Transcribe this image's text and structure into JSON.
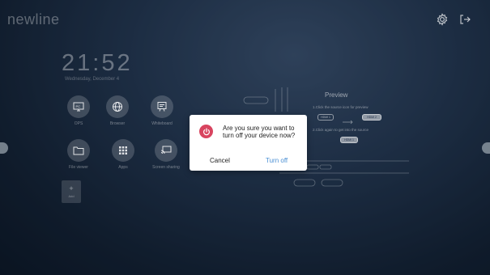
{
  "brand": {
    "logo_text": "newline"
  },
  "top_bar": {
    "settings_icon": "gear-icon",
    "exit_icon": "exit-icon"
  },
  "clock": {
    "time": "21:52",
    "date": "Wednesday, December 4"
  },
  "apps": [
    {
      "label": "OPS",
      "icon": "pc-icon"
    },
    {
      "label": "Browser",
      "icon": "globe-icon"
    },
    {
      "label": "Whiteboard",
      "icon": "whiteboard-icon"
    },
    {
      "label": "File viewer",
      "icon": "folder-icon"
    },
    {
      "label": "Apps",
      "icon": "grid-icon"
    },
    {
      "label": "Screen sharing",
      "icon": "cast-icon"
    }
  ],
  "add_tile": {
    "label": "Add"
  },
  "preview": {
    "title": "Preview",
    "step1": "1.Click the source icon for preview",
    "step2": "2.Click again to get into the source",
    "source_a": "HDMI 1",
    "source_b": "HDMI 2",
    "source_c": "HDMI 1"
  },
  "dialog": {
    "message": "Are you sure you want to turn off your device now?",
    "cancel_label": "Cancel",
    "confirm_label": "Turn off",
    "icon": "power-icon",
    "accent": "#d8445f",
    "link_color": "#4a8fd4"
  }
}
